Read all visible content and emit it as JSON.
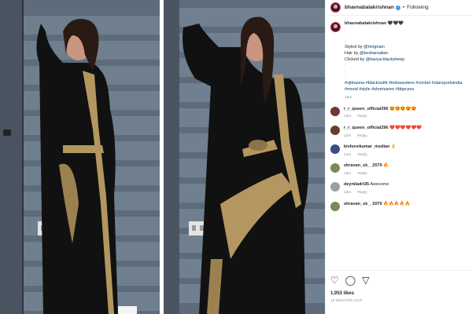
{
  "header": {
    "username": "bhavnabalakrishnan",
    "separator": "•",
    "follow_status": "Following"
  },
  "caption": {
    "username": "bhavnabalakrishnan",
    "emoji": "🖤🖤🖤",
    "dots": [
      ".",
      ".",
      "."
    ],
    "styled_prefix": "Styled by",
    "styled_by": "@mrignain",
    "hair_prefix": "Hair by",
    "hair_by": "@kesharsalian",
    "clicked_prefix": "Clicked by",
    "clicked_by": "@kavya.blacksheep",
    "dots2": [
      ".",
      ".",
      "."
    ],
    "hashtags": "#vjbhavna #blackoutfit #indowestern #cricket #starsportsindia #mood #style #shortsaree #bbpcses",
    "time": "16m"
  },
  "comments": [
    {
      "user": "r_r_queen_official296",
      "text": "😍😍😍😍😍",
      "time": "13m",
      "reply": "Reply",
      "avatar_color": "#6b3b32"
    },
    {
      "user": "r_r_queen_official296",
      "text": "❤️❤️❤️❤️❤️❤️",
      "time": "13m",
      "reply": "Reply",
      "avatar_color": "#6b3b32"
    },
    {
      "user": "kishorekumar_msdian",
      "text": "👌",
      "time": "14m",
      "reply": "Reply",
      "avatar_color": "#3a4c8c"
    },
    {
      "user": "shravan_sk__2070",
      "text": "🔥",
      "time": "13m",
      "reply": "Reply",
      "avatar_color": "#7a8a5a"
    },
    {
      "user": "deyniladri35",
      "text": "Awesome",
      "time": "13m",
      "reply": "Reply",
      "avatar_color": "#9aa0a6"
    },
    {
      "user": "shravan_sk__2070",
      "text": "🔥🔥🔥🔥🔥",
      "time": "",
      "reply": "",
      "avatar_color": "#7a8a5a"
    }
  ],
  "actions": {
    "likes": "1,953 likes",
    "time_ago": "16 MINUTES AGO"
  },
  "icons": [
    "heart-icon",
    "comment-icon",
    "share-icon"
  ]
}
